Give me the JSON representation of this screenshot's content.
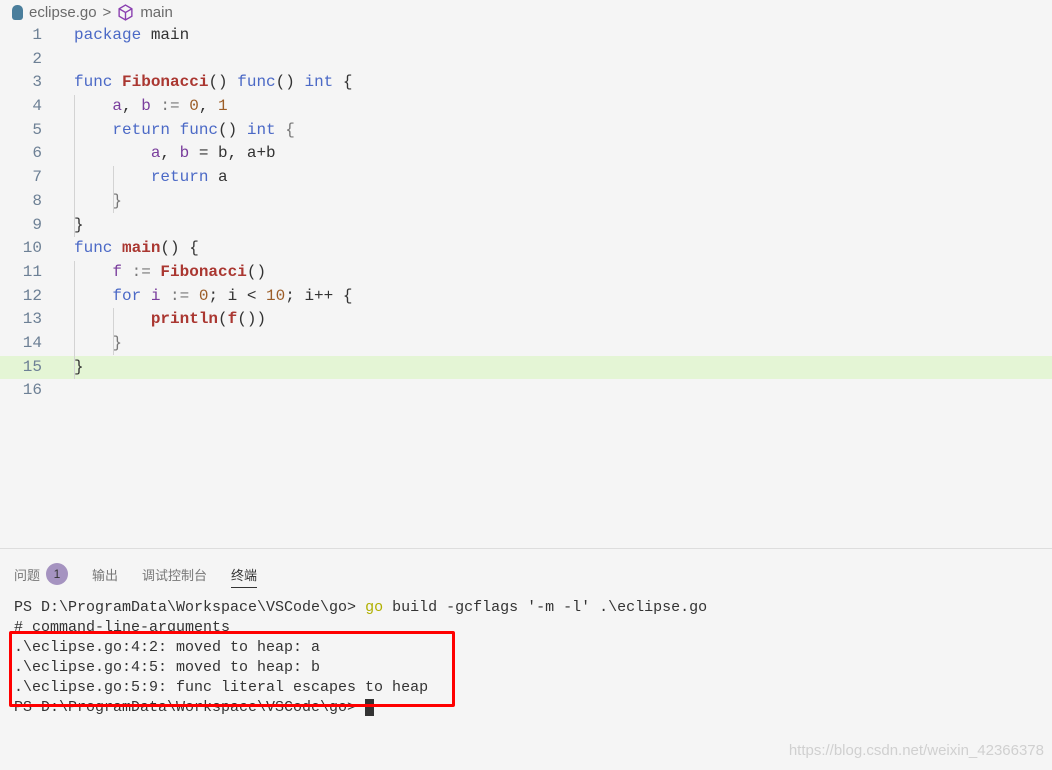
{
  "breadcrumb": {
    "file": "eclipse.go",
    "separator": ">",
    "symbol": "main",
    "file_icon": "go-gopher-icon",
    "symbol_icon": "cube-icon"
  },
  "editor": {
    "highlighted_line": 15,
    "lines": [
      {
        "n": "1",
        "tokens": [
          [
            "package",
            "kw"
          ],
          [
            " main",
            "txt"
          ]
        ]
      },
      {
        "n": "2",
        "tokens": []
      },
      {
        "n": "3",
        "tokens": [
          [
            "func ",
            "kw"
          ],
          [
            "Fibonacci",
            "fn"
          ],
          [
            "() ",
            "txt"
          ],
          [
            "func",
            "kw"
          ],
          [
            "() ",
            "txt"
          ],
          [
            "int",
            "kw"
          ],
          [
            " {",
            "txt"
          ]
        ]
      },
      {
        "n": "4",
        "tokens": [
          [
            "    ",
            "txt"
          ],
          [
            "a",
            "var"
          ],
          [
            ", ",
            "txt"
          ],
          [
            "b",
            "var"
          ],
          [
            " := ",
            "op"
          ],
          [
            "0",
            "num"
          ],
          [
            ", ",
            "txt"
          ],
          [
            "1",
            "num"
          ]
        ]
      },
      {
        "n": "5",
        "tokens": [
          [
            "    ",
            "txt"
          ],
          [
            "return ",
            "kw"
          ],
          [
            "func",
            "kw"
          ],
          [
            "() ",
            "txt"
          ],
          [
            "int",
            "kw"
          ],
          [
            " {",
            "op"
          ]
        ]
      },
      {
        "n": "6",
        "tokens": [
          [
            "        ",
            "txt"
          ],
          [
            "a",
            "var"
          ],
          [
            ", ",
            "txt"
          ],
          [
            "b",
            "var"
          ],
          [
            " = b, a+b",
            "txt"
          ]
        ]
      },
      {
        "n": "7",
        "tokens": [
          [
            "        ",
            "txt"
          ],
          [
            "return",
            "kw"
          ],
          [
            " a",
            "txt"
          ]
        ]
      },
      {
        "n": "8",
        "tokens": [
          [
            "    ",
            "txt"
          ],
          [
            "}",
            "op"
          ]
        ]
      },
      {
        "n": "9",
        "tokens": [
          [
            "}",
            "txt"
          ]
        ]
      },
      {
        "n": "10",
        "tokens": [
          [
            "func ",
            "kw"
          ],
          [
            "main",
            "fn"
          ],
          [
            "() {",
            "txt"
          ]
        ]
      },
      {
        "n": "11",
        "tokens": [
          [
            "    ",
            "txt"
          ],
          [
            "f",
            "var"
          ],
          [
            " := ",
            "op"
          ],
          [
            "Fibonacci",
            "fn"
          ],
          [
            "()",
            "txt"
          ]
        ]
      },
      {
        "n": "12",
        "tokens": [
          [
            "    ",
            "txt"
          ],
          [
            "for ",
            "kw"
          ],
          [
            "i",
            "var"
          ],
          [
            " := ",
            "op"
          ],
          [
            "0",
            "num"
          ],
          [
            "; i < ",
            "txt"
          ],
          [
            "10",
            "num"
          ],
          [
            "; i++ {",
            "txt"
          ]
        ]
      },
      {
        "n": "13",
        "tokens": [
          [
            "        ",
            "txt"
          ],
          [
            "println",
            "fn"
          ],
          [
            "(",
            "txt"
          ],
          [
            "f",
            "fn"
          ],
          [
            "())",
            "txt"
          ]
        ]
      },
      {
        "n": "14",
        "tokens": [
          [
            "    ",
            "txt"
          ],
          [
            "}",
            "op"
          ]
        ]
      },
      {
        "n": "15",
        "tokens": [
          [
            "}",
            "txt"
          ]
        ]
      },
      {
        "n": "16",
        "tokens": []
      }
    ]
  },
  "panel": {
    "tabs": [
      {
        "label": "问题",
        "badge": "1"
      },
      {
        "label": "输出"
      },
      {
        "label": "调试控制台"
      },
      {
        "label": "终端",
        "active": true
      }
    ],
    "terminal": {
      "prompt": "PS D:\\ProgramData\\Workspace\\VSCode\\go> ",
      "command_go": "go",
      "command_rest": " build -gcflags '-m -l' .\\eclipse.go",
      "output": [
        "# command-line-arguments",
        ".\\eclipse.go:4:2: moved to heap: a",
        ".\\eclipse.go:4:5: moved to heap: b",
        ".\\eclipse.go:5:9: func literal escapes to heap"
      ],
      "final_prompt": "PS D:\\ProgramData\\Workspace\\VSCode\\go>"
    }
  },
  "watermark": "https://blog.csdn.net/weixin_42366378"
}
